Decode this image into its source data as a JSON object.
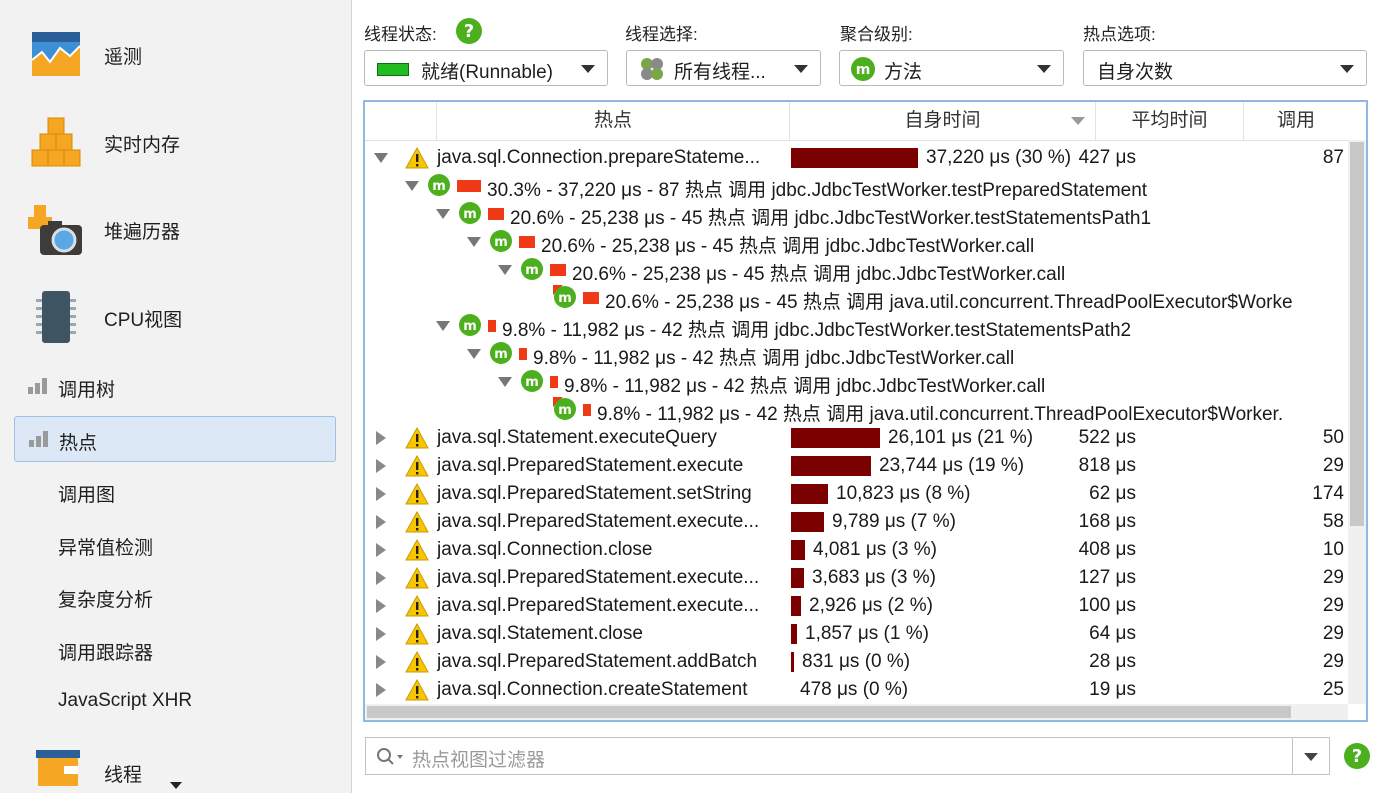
{
  "sidebar": {
    "big_items": [
      {
        "label": "遥测",
        "icon": "telemetry-icon"
      },
      {
        "label": "实时内存",
        "icon": "live-memory-icon"
      },
      {
        "label": "堆遍历器",
        "icon": "heap-walker-icon"
      },
      {
        "label": "CPU视图",
        "icon": "cpu-views-icon"
      }
    ],
    "cpu_items": [
      {
        "label": "调用树",
        "icon": "bar-chart-icon"
      },
      {
        "label": "热点",
        "icon": "bar-chart-icon",
        "selected": true
      }
    ],
    "plain_items": [
      "调用图",
      "异常值检测",
      "复杂度分析",
      "调用跟踪器",
      "JavaScript XHR"
    ],
    "bottom_item": {
      "label": "线程",
      "icon": "threads-icon"
    }
  },
  "controls": {
    "thread_status": {
      "label": "线程状态:",
      "value": "就绪(Runnable)",
      "swatch_color": "#22bb22"
    },
    "thread_select": {
      "label": "线程选择:",
      "value": "所有线程..."
    },
    "aggregation": {
      "label": "聚合级别:",
      "value": "方法"
    },
    "hotspot_option": {
      "label": "热点选项:",
      "value": "自身次数"
    }
  },
  "table": {
    "columns": [
      "热点",
      "自身时间",
      "平均时间",
      "调用"
    ],
    "expanded_row": {
      "name": "java.sql.Connection.prepareStateme...",
      "self_time": "37,220 μs (30 %)",
      "bar_fraction": 0.3,
      "avg": "427 μs",
      "calls": "87"
    },
    "backtraces": [
      {
        "depth": 1,
        "expanded": true,
        "pct": 0.303,
        "text": "30.3% - 37,220 μs - 87 热点 调用 jdbc.JdbcTestWorker.testPreparedStatement"
      },
      {
        "depth": 2,
        "expanded": true,
        "pct": 0.206,
        "text": "20.6% - 25,238 μs - 45 热点 调用 jdbc.JdbcTestWorker.testStatementsPath1"
      },
      {
        "depth": 3,
        "expanded": true,
        "pct": 0.206,
        "text": "20.6% - 25,238 μs - 45 热点 调用 jdbc.JdbcTestWorker.call"
      },
      {
        "depth": 4,
        "expanded": true,
        "pct": 0.206,
        "text": "20.6% - 25,238 μs - 45 热点 调用 jdbc.JdbcTestWorker.call"
      },
      {
        "depth": 5,
        "expanded": false,
        "pct": 0.206,
        "text": "20.6% - 25,238 μs - 45 热点 调用 java.util.concurrent.ThreadPoolExecutor$Worke"
      },
      {
        "depth": 2,
        "expanded": true,
        "pct": 0.098,
        "text": "9.8% - 11,982 μs - 42 热点 调用 jdbc.JdbcTestWorker.testStatementsPath2"
      },
      {
        "depth": 3,
        "expanded": true,
        "pct": 0.098,
        "text": "9.8% - 11,982 μs - 42 热点 调用 jdbc.JdbcTestWorker.call"
      },
      {
        "depth": 4,
        "expanded": true,
        "pct": 0.098,
        "text": "9.8% - 11,982 μs - 42 热点 调用 jdbc.JdbcTestWorker.call"
      },
      {
        "depth": 5,
        "expanded": false,
        "pct": 0.098,
        "text": "9.8% - 11,982 μs - 42 热点 调用 java.util.concurrent.ThreadPoolExecutor$Worker."
      }
    ],
    "rows": [
      {
        "name": "java.sql.Statement.executeQuery",
        "self_time": "26,101 μs (21 %)",
        "bar_fraction": 0.21,
        "avg": "522 μs",
        "calls": "50"
      },
      {
        "name": "java.sql.PreparedStatement.execute",
        "self_time": "23,744 μs (19 %)",
        "bar_fraction": 0.19,
        "avg": "818 μs",
        "calls": "29"
      },
      {
        "name": "java.sql.PreparedStatement.setString",
        "self_time": "10,823 μs (8 %)",
        "bar_fraction": 0.087,
        "avg": "62 μs",
        "calls": "174"
      },
      {
        "name": "java.sql.PreparedStatement.execute...",
        "self_time": "9,789 μs (7 %)",
        "bar_fraction": 0.079,
        "avg": "168 μs",
        "calls": "58"
      },
      {
        "name": "java.sql.Connection.close",
        "self_time": "4,081 μs (3 %)",
        "bar_fraction": 0.033,
        "avg": "408 μs",
        "calls": "10"
      },
      {
        "name": "java.sql.PreparedStatement.execute...",
        "self_time": "3,683 μs (3 %)",
        "bar_fraction": 0.03,
        "avg": "127 μs",
        "calls": "29"
      },
      {
        "name": "java.sql.PreparedStatement.execute...",
        "self_time": "2,926 μs (2 %)",
        "bar_fraction": 0.024,
        "avg": "100 μs",
        "calls": "29"
      },
      {
        "name": "java.sql.Statement.close",
        "self_time": "1,857 μs (1 %)",
        "bar_fraction": 0.015,
        "avg": "64 μs",
        "calls": "29"
      },
      {
        "name": "java.sql.PreparedStatement.addBatch",
        "self_time": "831 μs (0 %)",
        "bar_fraction": 0.007,
        "avg": "28 μs",
        "calls": "29"
      },
      {
        "name": "java.sql.Connection.createStatement",
        "self_time": "478 μs (0 %)",
        "bar_fraction": 0.004,
        "avg": "19 μs",
        "calls": "25"
      }
    ]
  },
  "filter": {
    "placeholder": "热点视图过滤器"
  },
  "colors": {
    "accent": "#8fb8e3",
    "bar": "#7b0000",
    "backtrace_bar": "#f03a17",
    "help": "#4caf1e"
  }
}
